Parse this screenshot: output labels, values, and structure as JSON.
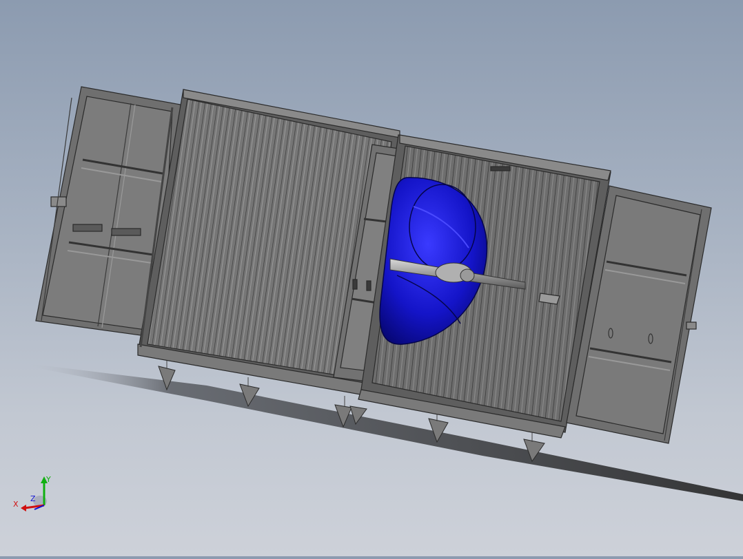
{
  "viewport": {
    "background_top": "#8c9bb0",
    "background_bottom": "#cdd1d9",
    "model_color": "#6b6b6b",
    "fan_color": "#1414c8"
  },
  "triad": {
    "x_label": "X",
    "y_label": "Y",
    "z_label": "Z",
    "x_color": "#d01010",
    "y_color": "#10b010",
    "z_color": "#1010d0"
  }
}
